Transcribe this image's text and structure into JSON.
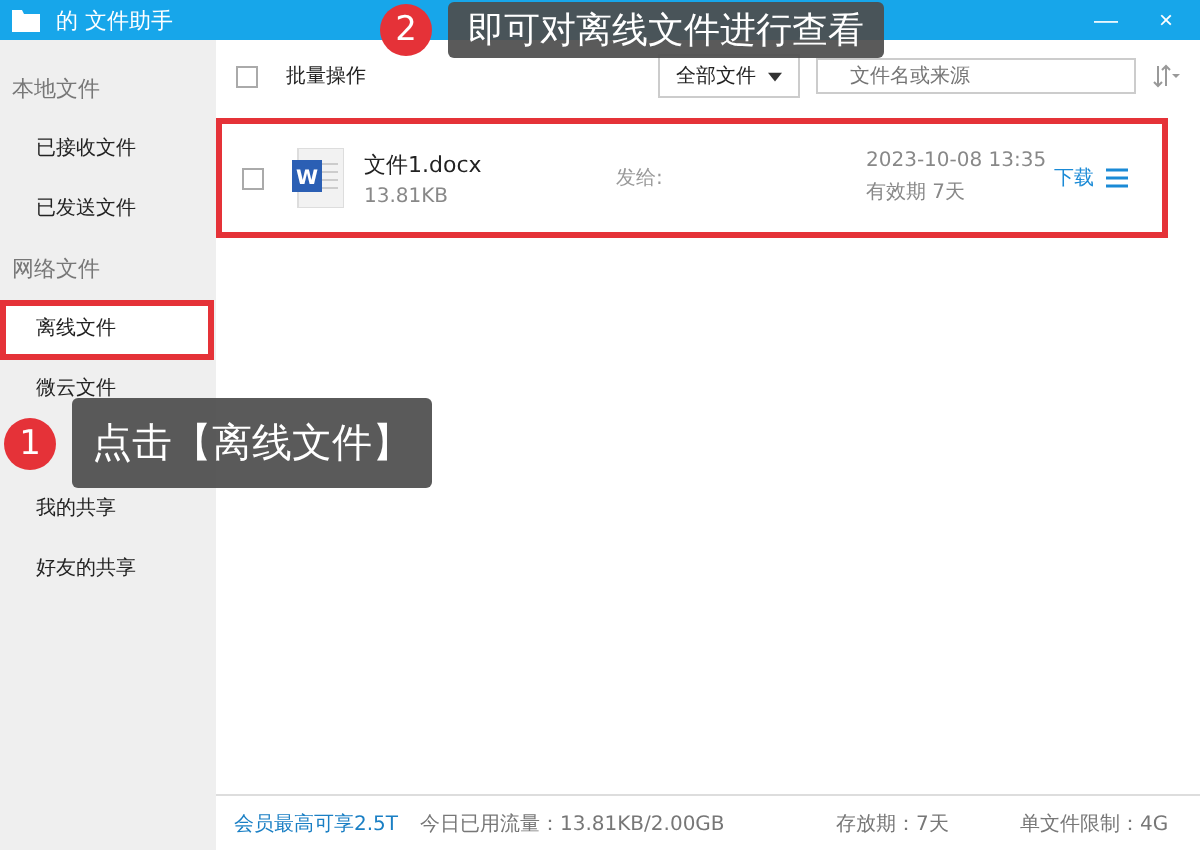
{
  "window": {
    "title": "的 文件助手",
    "controls": [
      "—",
      "×"
    ]
  },
  "sidebar": {
    "sections": [
      {
        "title": "本地文件",
        "items": [
          {
            "label": "已接收文件",
            "selected": false,
            "highlighted": false
          },
          {
            "label": "已发送文件",
            "selected": false,
            "highlighted": false
          }
        ]
      },
      {
        "title": "网络文件",
        "items": [
          {
            "label": "离线文件",
            "selected": true,
            "highlighted": true
          },
          {
            "label": "微云文件",
            "selected": false,
            "highlighted": false
          },
          {
            "selected": false,
            "highlighted": false
          },
          {
            "label": "我的共享",
            "selected": false,
            "highlighted": false
          },
          {
            "label": "好友的共享",
            "selected": false,
            "highlighted": false
          }
        ]
      }
    ]
  },
  "toolbar": {
    "select_all_checked": false,
    "batch_label": "批量操作",
    "filter": "全部文件",
    "search": {
      "placeholder": "文件名或来源"
    }
  },
  "files": [
    {
      "icon_letter": "W",
      "name": "文件1.docx",
      "size": "13.81KB",
      "sent_to": "发给:",
      "date": "2023-10-08 13:35",
      "validity": "有效期 7天",
      "action": "下载",
      "highlighted": true,
      "checked": false
    }
  ],
  "status_bar": {
    "vip": "会员最高可享2.5T",
    "traffic": "今日已用流量：13.81KB/2.00GB",
    "storage": "存放期：7天",
    "limit": "单文件限制：4G"
  },
  "callouts": [
    {
      "number": "2",
      "text": "即可对离线文件进行查看"
    },
    {
      "number": "1",
      "text": "点击【离线文件】"
    }
  ]
}
